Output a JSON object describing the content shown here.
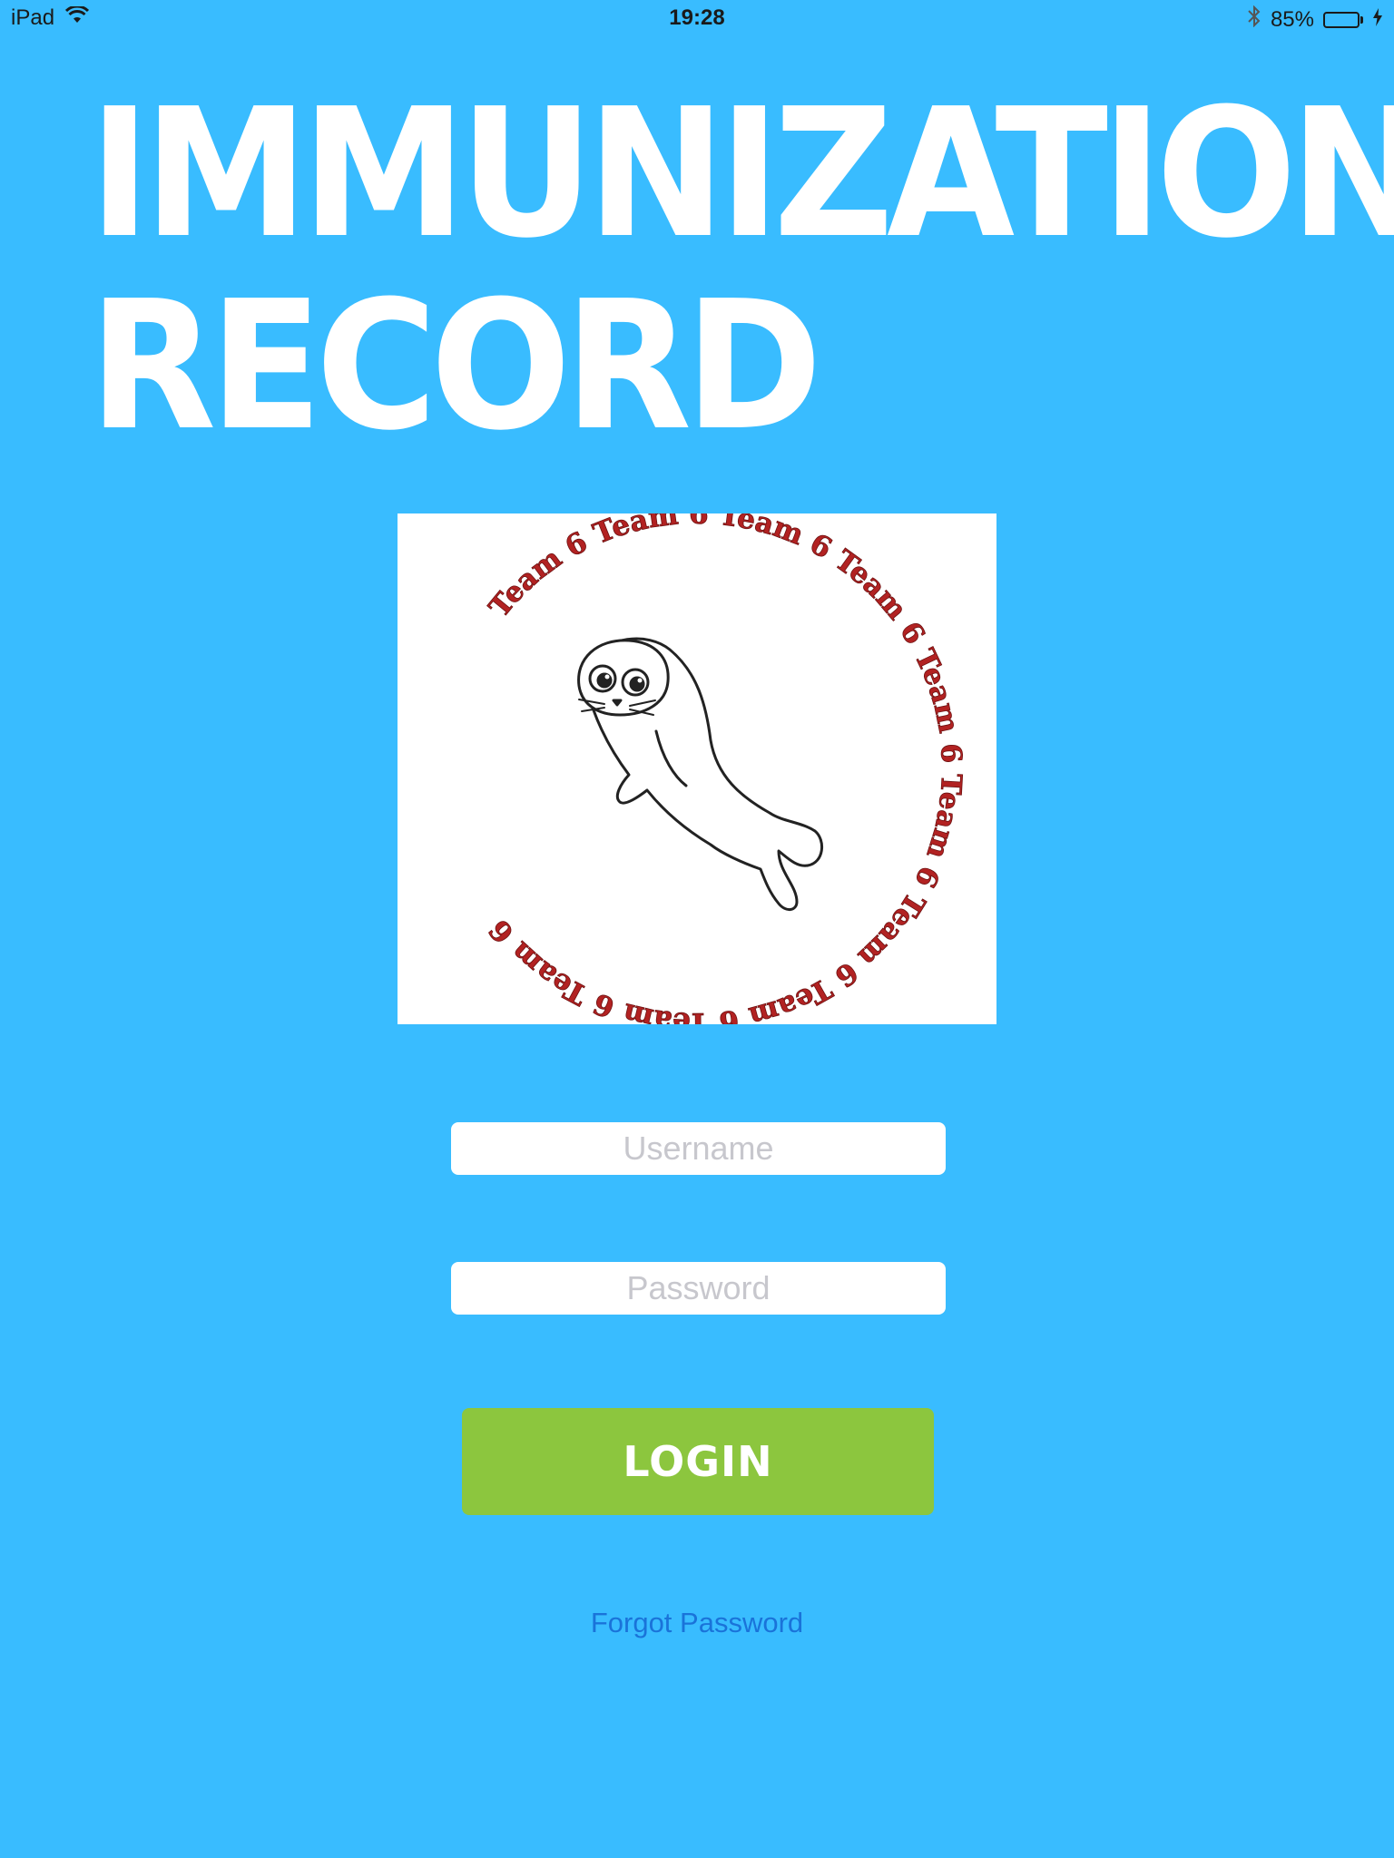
{
  "status_bar": {
    "device": "iPad",
    "time": "19:28",
    "battery_percent": "85%",
    "battery_level": 0.85,
    "icons": [
      "wifi-icon",
      "bluetooth-icon",
      "battery-icon",
      "charging-icon"
    ]
  },
  "app": {
    "title_line1": "IMMUNIZATION",
    "title_line2": "RECORD"
  },
  "logo": {
    "ring_text": "Team 6 Team 6 Team 6 Team 6 Team 6 Team 6 Team 6 Team 6 Team 6 Team 6",
    "ring_color": "#b22222"
  },
  "login_form": {
    "username_placeholder": "Username",
    "username_value": "",
    "password_placeholder": "Password",
    "password_value": "",
    "login_label": "LOGIN",
    "forgot_label": "Forgot Password"
  },
  "colors": {
    "background": "#39bcff",
    "login_button": "#8cc63e",
    "link": "#1a73d9"
  }
}
